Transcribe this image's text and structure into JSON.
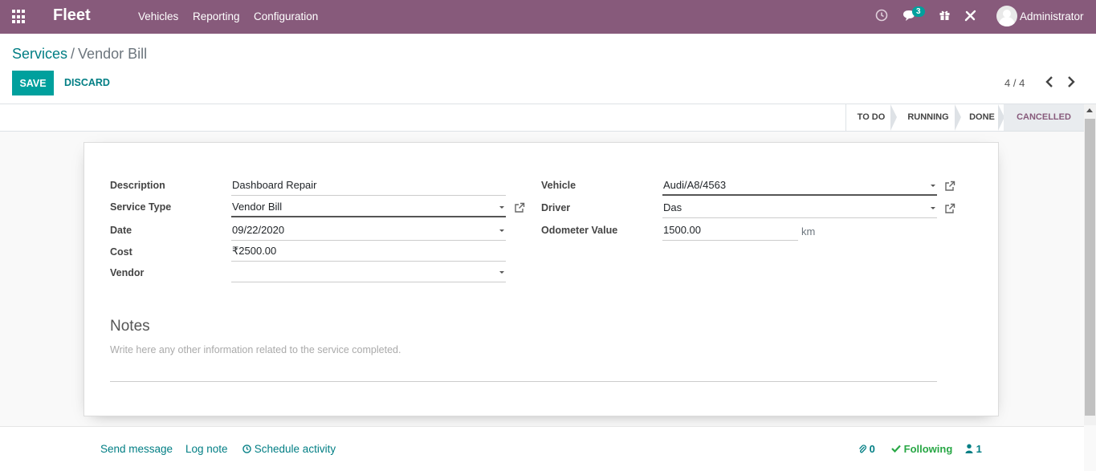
{
  "navbar": {
    "app_name": "Fleet",
    "menu": [
      "Vehicles",
      "Reporting",
      "Configuration"
    ],
    "message_count": "3",
    "user_name": "Administrator",
    "color": "#875a7b"
  },
  "breadcrumb": {
    "parent": "Services",
    "separator": "/",
    "current": "Vendor Bill"
  },
  "buttons": {
    "save": "SAVE",
    "discard": "DISCARD"
  },
  "pager": {
    "value": "4 / 4"
  },
  "stages": [
    {
      "label": "TO DO"
    },
    {
      "label": "RUNNING"
    },
    {
      "label": "DONE"
    },
    {
      "label": "CANCELLED"
    }
  ],
  "form": {
    "description": {
      "label": "Description",
      "value": "Dashboard Repair"
    },
    "service_type": {
      "label": "Service Type",
      "value": "Vendor Bill"
    },
    "date": {
      "label": "Date",
      "value": "09/22/2020"
    },
    "cost": {
      "label": "Cost",
      "value": "₹2500.00"
    },
    "vendor": {
      "label": "Vendor",
      "value": ""
    },
    "vehicle": {
      "label": "Vehicle",
      "value": "Audi/A8/4563"
    },
    "driver": {
      "label": "Driver",
      "value": "Das"
    },
    "odometer": {
      "label": "Odometer Value",
      "value": "1500.00",
      "unit": "km"
    }
  },
  "notes": {
    "title": "Notes",
    "placeholder": "Write here any other information related to the service completed."
  },
  "chatter": {
    "send_message": "Send message",
    "log_note": "Log note",
    "schedule_activity": "Schedule activity",
    "attachments": "0",
    "following": "Following",
    "followers": "1"
  },
  "colors": {
    "accent": "#00a09d",
    "link": "#017e84",
    "following": "#28a745"
  }
}
